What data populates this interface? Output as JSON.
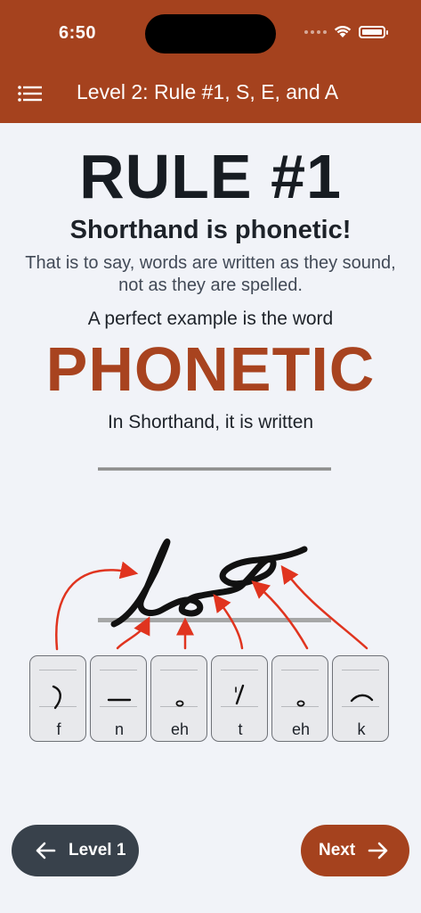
{
  "status_bar": {
    "time": "6:50"
  },
  "header": {
    "title": "Level 2: Rule #1, S, E, and A",
    "menu_icon": "list-menu-icon"
  },
  "lesson": {
    "rule_title": "RULE #1",
    "subtitle": "Shorthand is phonetic!",
    "explanation": "That is to say, words are written as they sound, not as they are spelled.",
    "example_intro": "A perfect example is the word",
    "example_word": "PHONETIC",
    "written_intro": "In Shorthand, it is written"
  },
  "keys": [
    {
      "label": "f",
      "symbol": "f-stroke-icon"
    },
    {
      "label": "n",
      "symbol": "n-stroke-icon"
    },
    {
      "label": "eh",
      "symbol": "e-circle-icon"
    },
    {
      "label": "t",
      "symbol": "t-stroke-icon"
    },
    {
      "label": "eh",
      "symbol": "e-circle-icon"
    },
    {
      "label": "k",
      "symbol": "k-stroke-icon"
    }
  ],
  "nav": {
    "prev_label": "Level 1",
    "next_label": "Next"
  },
  "colors": {
    "header": "#a5421e",
    "accent": "#a8431f",
    "arrows": "#e0341f",
    "secondary_button": "#38414b"
  }
}
